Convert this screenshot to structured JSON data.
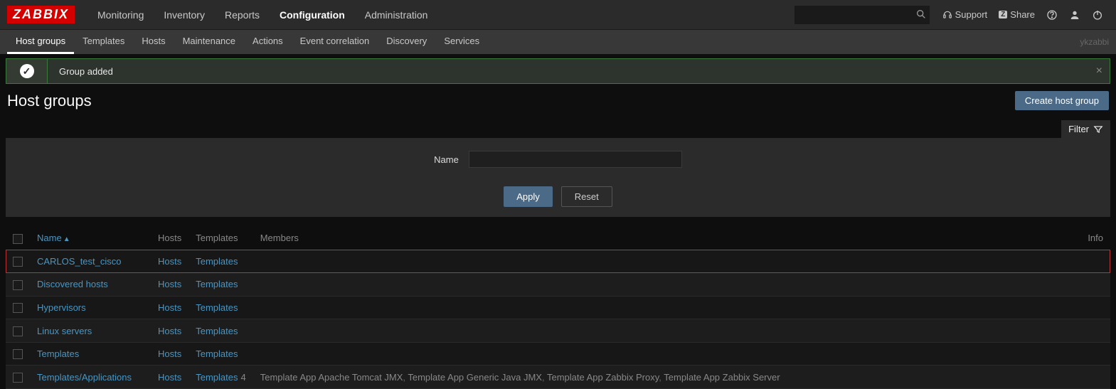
{
  "logo": "ZABBIX",
  "topnav": {
    "items": [
      "Monitoring",
      "Inventory",
      "Reports",
      "Configuration",
      "Administration"
    ],
    "activeIndex": 3
  },
  "topright": {
    "support": "Support",
    "share": "Share",
    "share_badge": "Z"
  },
  "subnav": {
    "items": [
      "Host groups",
      "Templates",
      "Hosts",
      "Maintenance",
      "Actions",
      "Event correlation",
      "Discovery",
      "Services"
    ],
    "activeIndex": 0,
    "user": "ykzabbi"
  },
  "message": {
    "text": "Group added"
  },
  "page_title": "Host groups",
  "create_button": "Create host group",
  "filter": {
    "tab_label": "Filter",
    "name_label": "Name",
    "name_value": "",
    "apply": "Apply",
    "reset": "Reset"
  },
  "table": {
    "headers": {
      "name": "Name",
      "hosts": "Hosts",
      "templates": "Templates",
      "members": "Members",
      "info": "Info"
    },
    "rows": [
      {
        "name": "CARLOS_test_cisco",
        "hosts": "Hosts",
        "templates": "Templates",
        "templates_count": "",
        "members": [],
        "highlight": true
      },
      {
        "name": "Discovered hosts",
        "hosts": "Hosts",
        "templates": "Templates",
        "templates_count": "",
        "members": []
      },
      {
        "name": "Hypervisors",
        "hosts": "Hosts",
        "templates": "Templates",
        "templates_count": "",
        "members": []
      },
      {
        "name": "Linux servers",
        "hosts": "Hosts",
        "templates": "Templates",
        "templates_count": "",
        "members": []
      },
      {
        "name": "Templates",
        "hosts": "Hosts",
        "templates": "Templates",
        "templates_count": "",
        "members": []
      },
      {
        "name": "Templates/Applications",
        "hosts": "Hosts",
        "templates": "Templates",
        "templates_count": "4",
        "members": [
          "Template App Apache Tomcat JMX",
          "Template App Generic Java JMX",
          "Template App Zabbix Proxy",
          "Template App Zabbix Server"
        ]
      }
    ]
  }
}
